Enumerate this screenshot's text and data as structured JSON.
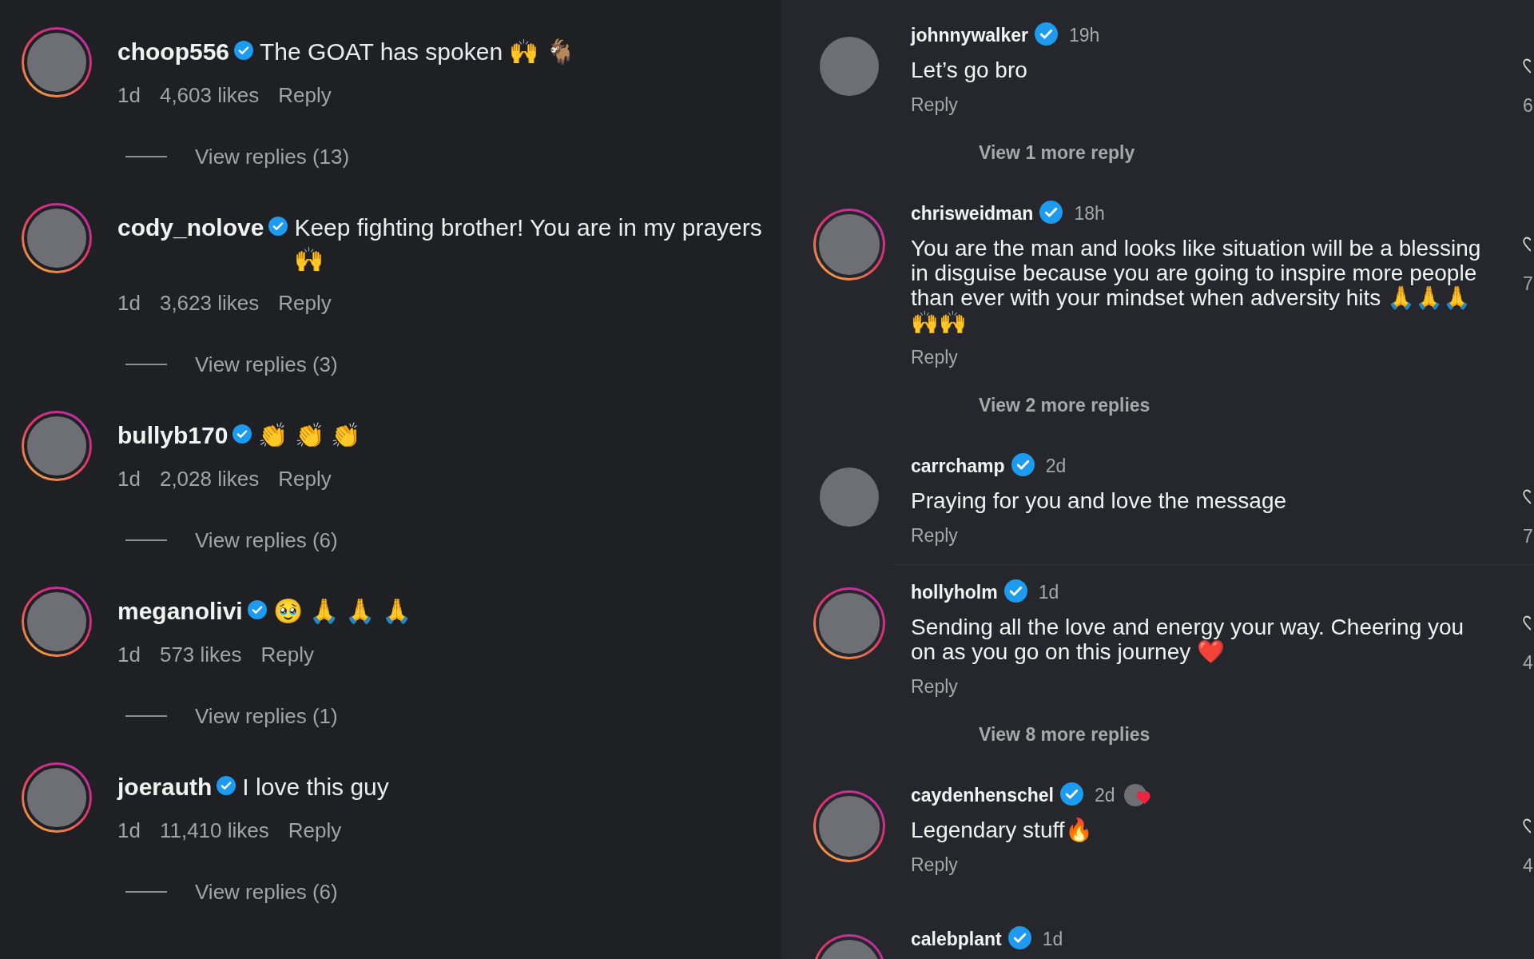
{
  "left_comments": [
    {
      "username": "choop556",
      "verified": true,
      "text": "The GOAT has spoken 🙌 🐐",
      "time": "1d",
      "likes": "4,603 likes",
      "reply": "Reply",
      "view_replies": "View replies (13)",
      "story_ring": true
    },
    {
      "username": "cody_nolove",
      "verified": true,
      "text": "Keep fighting brother! You are in my prayers 🙌",
      "time": "1d",
      "likes": "3,623 likes",
      "reply": "Reply",
      "view_replies": "View replies (3)",
      "story_ring": true
    },
    {
      "username": "bullyb170",
      "verified": true,
      "text": "👏 👏 👏",
      "time": "1d",
      "likes": "2,028 likes",
      "reply": "Reply",
      "view_replies": "View replies (6)",
      "story_ring": true
    },
    {
      "username": "meganolivi",
      "verified": true,
      "text": "🥹 🙏 🙏 🙏",
      "time": "1d",
      "likes": "573 likes",
      "reply": "Reply",
      "view_replies": "View replies (1)",
      "story_ring": true
    },
    {
      "username": "joerauth",
      "verified": true,
      "text": "I love this guy",
      "time": "1d",
      "likes": "11,410 likes",
      "reply": "Reply",
      "view_replies": "View replies (6)",
      "story_ring": true
    }
  ],
  "right_comments": [
    {
      "username": "johnnywalker",
      "verified": true,
      "time": "19h",
      "text": "Let’s go bro",
      "reply": "Reply",
      "view_more": "View 1 more reply",
      "story_ring": false,
      "liked_by_author": false,
      "like_count": "6"
    },
    {
      "username": "chrisweidman",
      "verified": true,
      "time": "18h",
      "text": "You are the man and looks like situation will be a blessing in disguise because you are going to inspire more people than ever with your mindset when adversity hits 🙏🙏🙏🙌🙌",
      "reply": "Reply",
      "view_more": "View 2 more replies",
      "story_ring": true,
      "liked_by_author": false,
      "like_count": "7"
    },
    {
      "username": "carrchamp",
      "verified": true,
      "time": "2d",
      "text": "Praying for you and love the message",
      "reply": "Reply",
      "story_ring": false,
      "liked_by_author": false,
      "like_count": "7",
      "divider_after": true
    },
    {
      "username": "hollyholm",
      "verified": true,
      "time": "1d",
      "text": "Sending all the love and energy your way. Cheering you on as you go on this journey ❤️",
      "reply": "Reply",
      "view_more": "View 8 more replies",
      "story_ring": true,
      "liked_by_author": false,
      "like_count": "4"
    },
    {
      "username": "caydenhenschel",
      "verified": true,
      "time": "2d",
      "text": "Legendary stuff🔥",
      "reply": "Reply",
      "story_ring": true,
      "liked_by_author": true,
      "like_count": "4"
    },
    {
      "username": "calebplant",
      "verified": true,
      "time": "1d",
      "story_ring": true,
      "liked_by_author": false
    }
  ]
}
